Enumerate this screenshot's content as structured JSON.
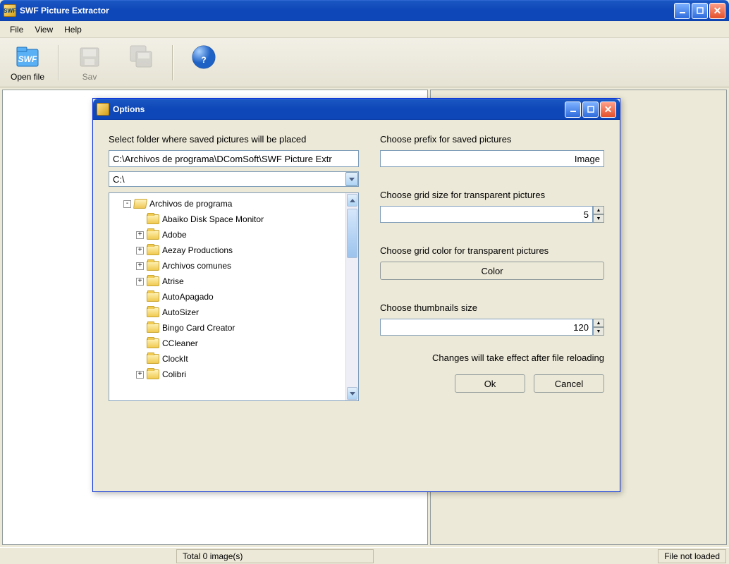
{
  "app": {
    "title": "SWF Picture Extractor",
    "menus": [
      "File",
      "View",
      "Help"
    ],
    "toolbar": {
      "open": "Open file",
      "save": "Sav",
      "help_icon": "help-icon"
    },
    "statusbar": {
      "total": "Total 0 image(s)",
      "right": "File not loaded"
    }
  },
  "modal": {
    "title": "Options",
    "left": {
      "folder_label": "Select folder where saved pictures will be placed",
      "path_value": "C:\\Archivos de programa\\DComSoft\\SWF Picture Extr",
      "drive_value": "C:\\",
      "tree": [
        {
          "depth": 0,
          "expander": "-",
          "open": true,
          "label": "Archivos de programa"
        },
        {
          "depth": 1,
          "expander": "",
          "open": false,
          "label": "Abaiko Disk Space Monitor"
        },
        {
          "depth": 1,
          "expander": "+",
          "open": false,
          "label": "Adobe"
        },
        {
          "depth": 1,
          "expander": "+",
          "open": false,
          "label": "Aezay Productions"
        },
        {
          "depth": 1,
          "expander": "+",
          "open": false,
          "label": "Archivos comunes"
        },
        {
          "depth": 1,
          "expander": "+",
          "open": false,
          "label": "Atrise"
        },
        {
          "depth": 1,
          "expander": "",
          "open": false,
          "label": "AutoApagado"
        },
        {
          "depth": 1,
          "expander": "",
          "open": false,
          "label": "AutoSizer"
        },
        {
          "depth": 1,
          "expander": "",
          "open": false,
          "label": "Bingo Card Creator"
        },
        {
          "depth": 1,
          "expander": "",
          "open": false,
          "label": "CCleaner"
        },
        {
          "depth": 1,
          "expander": "",
          "open": false,
          "label": "ClockIt"
        },
        {
          "depth": 1,
          "expander": "+",
          "open": false,
          "label": "Colibri"
        }
      ]
    },
    "right": {
      "prefix_label": "Choose prefix for saved pictures",
      "prefix_value": "Image",
      "gridsize_label": "Choose grid size for transparent pictures",
      "gridsize_value": "5",
      "gridcolor_label": "Choose grid color for transparent pictures",
      "color_btn": "Color",
      "thumbsize_label": "Choose thumbnails size",
      "thumbsize_value": "120",
      "effect_note": "Changes will take effect after file reloading",
      "ok": "Ok",
      "cancel": "Cancel"
    }
  }
}
